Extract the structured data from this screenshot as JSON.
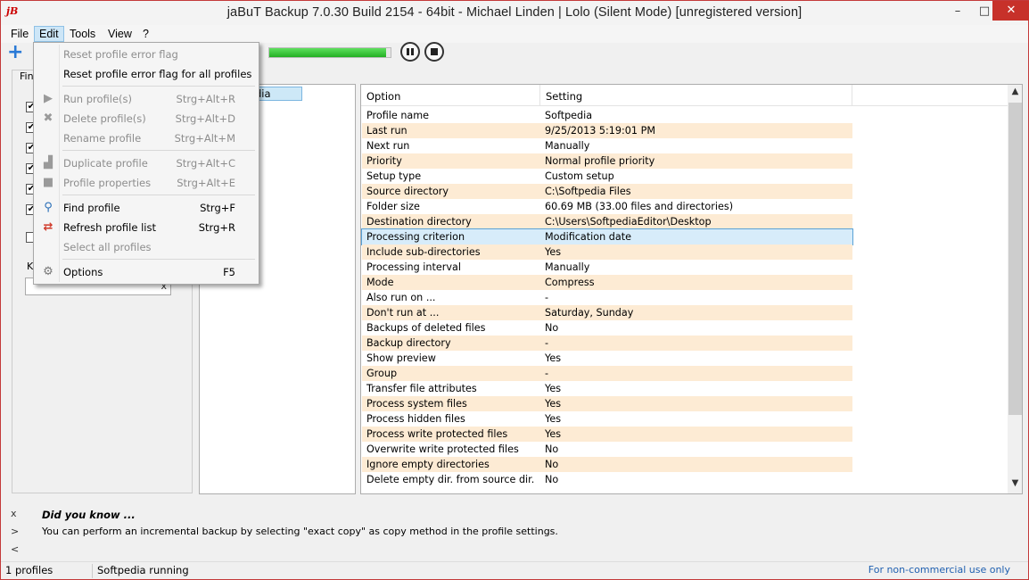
{
  "window": {
    "title": "jaBuT Backup 7.0.30 Build 2154 - 64bit - Michael Linden    |    Lolo (Silent Mode) [unregistered version]",
    "app_icon_text": "jB",
    "minimize": "–",
    "maximize": "□",
    "close": "✕"
  },
  "menubar": {
    "file": "File",
    "edit": "Edit",
    "tools": "Tools",
    "view": "View",
    "help": "?"
  },
  "edit_menu": {
    "reset_flag": "Reset profile error flag",
    "reset_flag_all": "Reset profile error flag for all profiles",
    "run": {
      "label": "Run profile(s)",
      "shortcut": "Strg+Alt+R"
    },
    "delete": {
      "label": "Delete profile(s)",
      "shortcut": "Strg+Alt+D"
    },
    "rename": {
      "label": "Rename profile",
      "shortcut": "Strg+Alt+M"
    },
    "duplicate": {
      "label": "Duplicate profile",
      "shortcut": "Strg+Alt+C"
    },
    "properties": {
      "label": "Profile properties",
      "shortcut": "Strg+Alt+E"
    },
    "find": {
      "label": "Find profile",
      "shortcut": "Strg+F"
    },
    "refresh": {
      "label": "Refresh profile list",
      "shortcut": "Strg+R"
    },
    "select_all": {
      "label": "Select all profiles"
    },
    "options": {
      "label": "Options",
      "shortcut": "F5"
    }
  },
  "toolbar": {
    "progress_fraction": 0.96
  },
  "left_panel": {
    "find_label": "Find",
    "k_label": "K",
    "search_clear": "x"
  },
  "profiles": {
    "items": [
      "dia"
    ]
  },
  "settings": {
    "headers": {
      "option": "Option",
      "setting": "Setting"
    },
    "rows": [
      {
        "option": "Profile name",
        "value": "Softpedia"
      },
      {
        "option": "Last run",
        "value": "9/25/2013 5:19:01 PM"
      },
      {
        "option": "Next run",
        "value": "Manually"
      },
      {
        "option": "Priority",
        "value": "Normal profile priority"
      },
      {
        "option": "Setup type",
        "value": "Custom setup"
      },
      {
        "option": "Source directory",
        "value": "C:\\Softpedia Files"
      },
      {
        "option": "Folder size",
        "value": "60.69 MB (33.00 files and directories)"
      },
      {
        "option": "Destination directory",
        "value": "C:\\Users\\SoftpediaEditor\\Desktop"
      },
      {
        "option": "Processing criterion",
        "value": "Modification date"
      },
      {
        "option": "Include sub-directories",
        "value": "Yes"
      },
      {
        "option": "Processing interval",
        "value": "Manually"
      },
      {
        "option": "Mode",
        "value": "Compress"
      },
      {
        "option": "Also run on ...",
        "value": "-"
      },
      {
        "option": "Don't run at ...",
        "value": "Saturday, Sunday"
      },
      {
        "option": "Backups of deleted files",
        "value": "No"
      },
      {
        "option": "Backup directory",
        "value": "-"
      },
      {
        "option": "Show preview",
        "value": "Yes"
      },
      {
        "option": "Group",
        "value": "-"
      },
      {
        "option": "Transfer file attributes",
        "value": "Yes"
      },
      {
        "option": "Process system files",
        "value": "Yes"
      },
      {
        "option": "Process hidden files",
        "value": "Yes"
      },
      {
        "option": "Process write protected files",
        "value": "Yes"
      },
      {
        "option": "Overwrite write protected files",
        "value": "No"
      },
      {
        "option": "Ignore empty directories",
        "value": "No"
      },
      {
        "option": "Delete empty dir. from source dir.",
        "value": "No"
      }
    ],
    "selected_row": "Processing criterion"
  },
  "tips": {
    "close": "x",
    "next": ">",
    "prev": "<",
    "title": "Did you know ...",
    "text": "You can perform an incremental backup by selecting \"exact copy\" as copy method in the profile settings."
  },
  "statusbar": {
    "profiles": "1 profiles",
    "running": "Softpedia running",
    "license": "For non-commercial use only"
  },
  "colors": {
    "alt_row": "#fdebd4",
    "selected_row": "#d7ecfa",
    "close_button": "#c7312a",
    "progress": "#23b023"
  }
}
